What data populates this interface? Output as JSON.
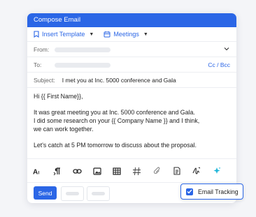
{
  "window": {
    "title": "Compose Email"
  },
  "toolbar": {
    "insert_template": "Insert Template",
    "meetings": "Meetings"
  },
  "fields": {
    "from_label": "From:",
    "to_label": "To:",
    "cc_bcc": "Cc / Bcc",
    "subject_label": "Subject:",
    "subject_value": "I met you at Inc. 5000 conference and Gala"
  },
  "body": {
    "greeting": "Hi {{ First Name}},",
    "line1": "It was great meeting you at Inc. 5000 conference and Gala.",
    "line2": "I did some research on your {{ Company Name }} and I think,",
    "line3": "we can work together.",
    "line4": "Let's catch at 5 PM tomorrow to discuss about the proposal."
  },
  "format_bar": {
    "icons": [
      "text-size-icon",
      "paragraph-icon",
      "link-icon",
      "image-icon",
      "table-icon",
      "hash-icon",
      "attachment-icon",
      "document-icon",
      "signature-icon",
      "ai-sparkle-icon"
    ]
  },
  "actions": {
    "send_label": "Send",
    "email_tracking_label": "Email Tracking",
    "email_tracking_checked": true
  },
  "colors": {
    "accent": "#2b66e6",
    "sparkle": "#1fb6d9"
  }
}
